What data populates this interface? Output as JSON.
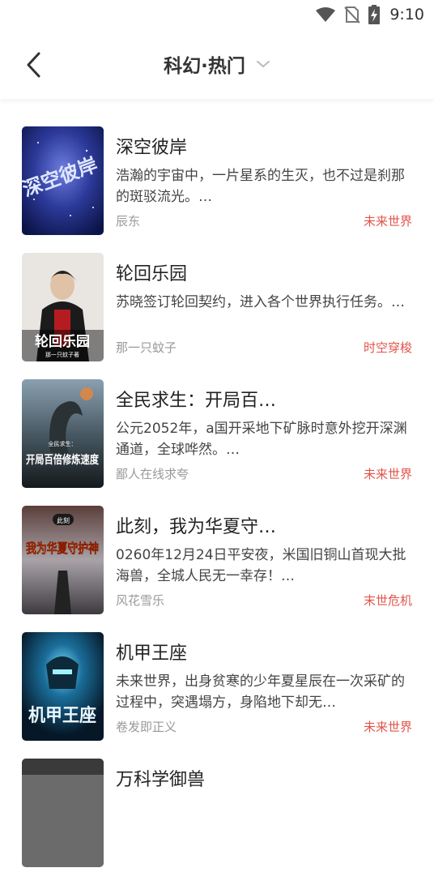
{
  "status": {
    "time": "9:10"
  },
  "header": {
    "title": "科幻·热门"
  },
  "books": [
    {
      "title": "深空彼岸",
      "desc": "浩瀚的宇宙中，一片星系的生灭，也不过是刹那的斑驳流光。…",
      "author": "辰东",
      "tag": "未来世界",
      "cover_text": "深空彼岸"
    },
    {
      "title": "轮回乐园",
      "desc": "苏晓签订轮回契约，进入各个世界执行任务。…",
      "author": "那一只蚊子",
      "tag": "时空穿梭",
      "cover_text": "轮回乐园",
      "cover_sub": "那一只蚊子著"
    },
    {
      "title": "全民求生：开局百…",
      "desc": "公元2052年，a国开采地下矿脉时意外挖开深渊通道，全球哗然。…",
      "author": "鄙人在线求夸",
      "tag": "未来世界",
      "cover_text": "开局百倍修炼速度",
      "cover_sub": "全民求生："
    },
    {
      "title": "此刻，我为华夏守…",
      "desc": "0260年12月24日平安夜，米国旧铜山首现大批海兽，全城人民无一幸存！…",
      "author": "风花雪乐",
      "tag": "末世危机",
      "cover_text": "我为华夏守护神",
      "cover_sub": "此刻"
    },
    {
      "title": "机甲王座",
      "desc": "未来世界，出身贫寒的少年夏星辰在一次采矿的过程中，突遇塌方，身陷地下却无…",
      "author": "卷发即正义",
      "tag": "未来世界",
      "cover_text": "机甲王座"
    },
    {
      "title": "万科学御兽",
      "desc": "",
      "author": "",
      "tag": "",
      "cover_text": ""
    }
  ]
}
